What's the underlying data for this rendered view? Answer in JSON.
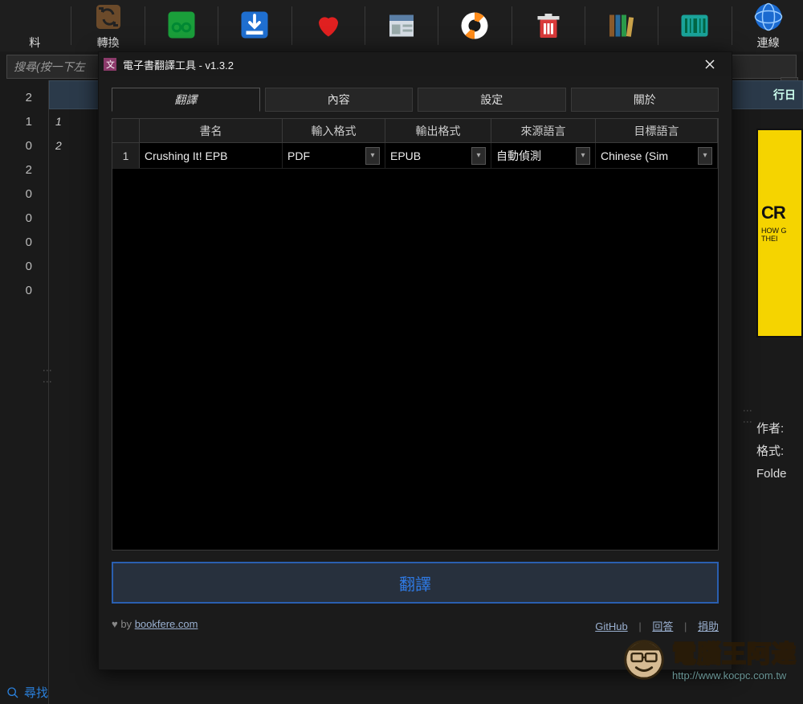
{
  "toolbar": {
    "items": [
      {
        "label": "料",
        "icon": "blank"
      },
      {
        "label": "轉換",
        "icon": "refresh"
      },
      {
        "label": "",
        "icon": "glasses"
      },
      {
        "label": "",
        "icon": "download"
      },
      {
        "label": "",
        "icon": "heart"
      },
      {
        "label": "",
        "icon": "news"
      },
      {
        "label": "",
        "icon": "lifebuoy"
      },
      {
        "label": "",
        "icon": "trash"
      },
      {
        "label": "",
        "icon": "books"
      },
      {
        "label": "",
        "icon": "barcode"
      },
      {
        "label": "連線",
        "icon": "globe"
      }
    ]
  },
  "search_placeholder": "搜尋(按一下左",
  "left_numbers": [
    "2",
    "1",
    "0",
    "2",
    "0",
    "0",
    "0",
    "0",
    "0"
  ],
  "mid_header_suffix": "行日",
  "mid_rows": [
    "1",
    "2"
  ],
  "right_meta": {
    "author_label": "作者:",
    "format_label": "格式:",
    "folder_label": "Folde"
  },
  "cover": {
    "t1": "CR",
    "t2a": "HOW G",
    "t2b": "THEI"
  },
  "footer_search": "尋找",
  "dialog": {
    "title": "電子書翻譯工具 - v1.3.2",
    "tabs": [
      "翻譯",
      "內容",
      "設定",
      "關於"
    ],
    "columns": [
      "書名",
      "輸入格式",
      "輸出格式",
      "來源語言",
      "目標語言"
    ],
    "rows": [
      {
        "num": "1",
        "name": "Crushing It! EPB",
        "in": "PDF",
        "out": "EPUB",
        "src": "自動偵測",
        "tgt": "Chinese (Sim"
      }
    ],
    "translate_btn": "翻譯",
    "footer_left_prefix": "♥ by ",
    "footer_left_link": "bookfere.com",
    "footer_right": {
      "github": "GitHub",
      "feedback": "回答",
      "donate": "捐助"
    }
  },
  "watermark": {
    "big": "電腦王阿達",
    "url": "http://www.kocpc.com.tw"
  }
}
